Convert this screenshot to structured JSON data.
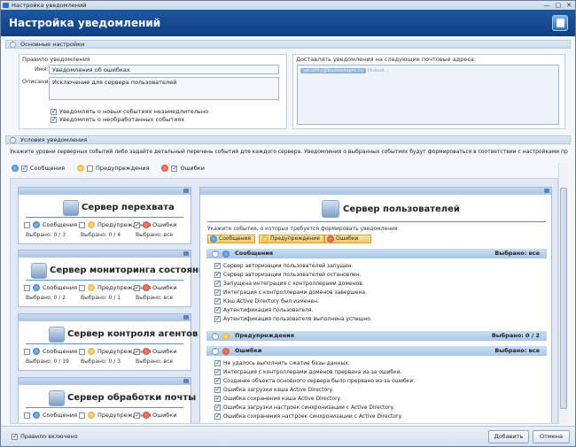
{
  "window": {
    "title": "Настройка уведомлений",
    "minimize": "—",
    "maximize": "□",
    "close": "✕"
  },
  "header": {
    "title": "Настройка уведомлений"
  },
  "sections": {
    "basic": "Основные настройки",
    "conditions": "Условия уведомления"
  },
  "rule": {
    "group_label": "Правило уведомления",
    "name_label": "Имя:",
    "name_value": "Уведомления об ошибках",
    "desc_label": "Описание:",
    "desc_value": "Исключение для сервера пользователей",
    "notify_new": "Уведомлять о новых событиях незамедлительно",
    "notify_unprocessed": "Уведомлять о необработанных событиях"
  },
  "delivery": {
    "label": "Доставлять уведомления на следующие почтовые адреса:",
    "email": "security@businesspro.ru",
    "new_placeholder": "Новый..."
  },
  "conditions": {
    "hint": "Укажите уровни серверных событий либо задайте детальный перечень событий для каждого сервера. Уведомления о выбранных событиях будут формироваться в соответствии с настройками правила",
    "levels": [
      "Сообщения",
      "Предупреждения",
      "Ошибки"
    ]
  },
  "servers": [
    {
      "name": "Сервер перехвата",
      "sel": [
        "Выбрано: 0 / 3",
        "Выбрано: 0 / 4",
        "Выбрано: все"
      ]
    },
    {
      "name": "Сервер мониторинга состояния",
      "sel": [
        "Выбрано: 0 / 2",
        "Выбрано: 0 / 1",
        "Выбрано: все"
      ]
    },
    {
      "name": "Сервер контроля агентов",
      "sel": [
        "Выбрано: 0 / 19",
        "Выбрано: 0 / 3",
        "Выбрано: все"
      ]
    },
    {
      "name": "Сервер обработки почты",
      "sel": [
        "",
        "",
        ""
      ]
    }
  ],
  "user_server": {
    "name": "Сервер пользователей",
    "prompt": "Укажите события, о которых требуется формировать уведомления",
    "buttons": [
      "Сообщения",
      "Предупреждения",
      "Ошибки"
    ],
    "messages": {
      "title": "Сообщения",
      "selected": "Выбрано: все",
      "events": [
        "Сервер авторизации пользователей запущен.",
        "Сервер авторизации пользователей остановлен.",
        "Запущена интеграция с контроллерами доменов.",
        "Интеграция с контроллерами доменов завершена.",
        "Кэш Active Directory был изменен.",
        "Аутентификация пользователя.",
        "Аутентификация пользователя выполнена успешно."
      ]
    },
    "warnings": {
      "title": "Предупреждения",
      "selected": "Выбрано: 0 / 2"
    },
    "errors": {
      "title": "Ошибки",
      "selected": "Выбрано: все",
      "events": [
        "Не удалось выполнить сжатие базы данных.",
        "Интеграция с контроллерами доменов прервана из-за ошибки.",
        "Создание объекта основного сервера было прервано из-за ошибки.",
        "Ошибка загрузки кэша Active Directory.",
        "Ошибка сохранения кэша Active Directory.",
        "Ошибка загрузки настроек синхронизации с Active Directory.",
        "Ошибка сохранения настроек синхронизации с Active Directory."
      ]
    }
  },
  "footer": {
    "enabled": "Правило включено",
    "add": "Добавить",
    "cancel": "Отмена"
  }
}
